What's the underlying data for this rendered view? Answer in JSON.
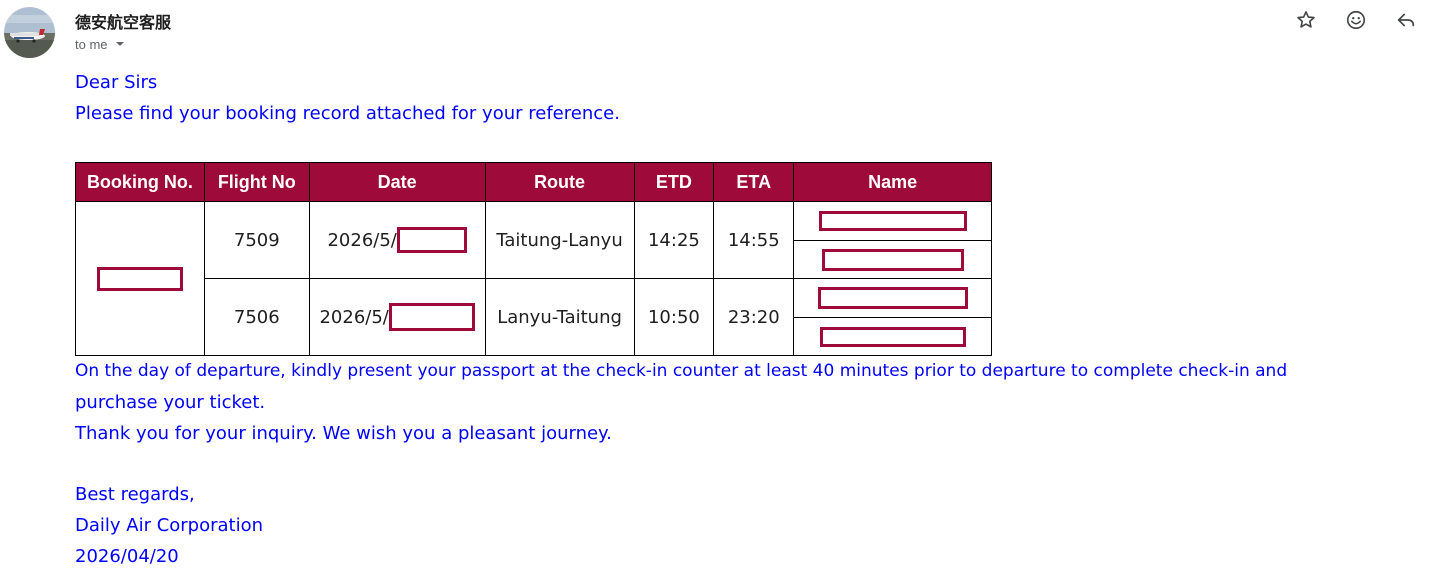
{
  "header": {
    "sender_name": "德安航空客服",
    "recipient_label": "to me",
    "actions": [
      {
        "name": "star-icon",
        "label": "Star"
      },
      {
        "name": "emoji-icon",
        "label": "Add reaction"
      },
      {
        "name": "reply-icon",
        "label": "Reply"
      }
    ]
  },
  "message": {
    "greeting": "Dear Sirs",
    "intro": "Please find your booking record attached for your reference.",
    "instructions_line1": "On the day of departure, kindly present your passport at the check-in counter at least 40 minutes prior to departure to complete check-in and",
    "instructions_line2": "purchase your ticket.",
    "thanks": "Thank you for your inquiry. We wish you a pleasant journey.",
    "signoff": "Best regards,",
    "company": "Daily Air Corporation",
    "date": "2026/04/20"
  },
  "booking_table": {
    "headers": [
      "Booking No.",
      "Flight No",
      "Date",
      "Route",
      "ETD",
      "ETA",
      "Name"
    ],
    "rows": [
      {
        "flight_no": "7509",
        "date_prefix": "2026/5/",
        "route": "Taitung-Lanyu",
        "etd": "14:25",
        "eta": "14:55"
      },
      {
        "flight_no": "7506",
        "date_prefix": "2026/5/",
        "route": "Lanyu-Taitung",
        "etd": "10:50",
        "eta": "23:20"
      }
    ],
    "redaction_color": "#9e0b3b",
    "header_color": "#9e0b3b"
  },
  "colors": {
    "body_text": "#0000ff",
    "header_bg": "#9e0b3b"
  }
}
